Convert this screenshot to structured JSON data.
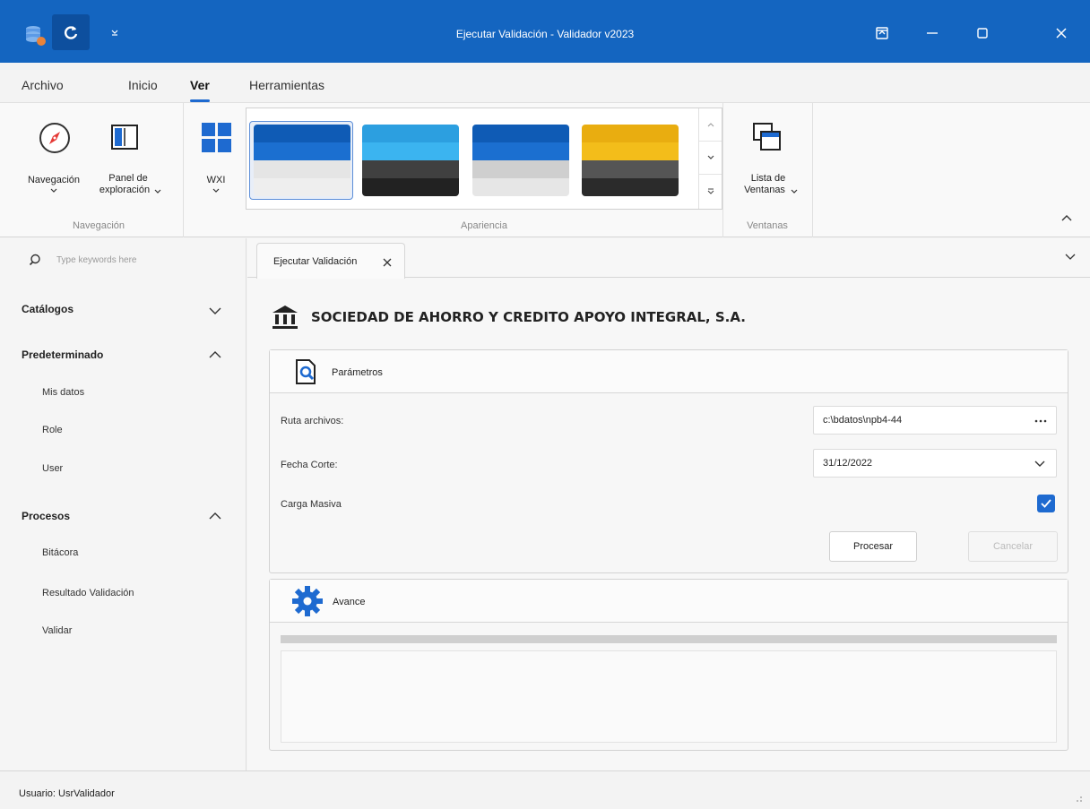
{
  "window": {
    "title": "Ejecutar Validación - Validador v2023",
    "accent": "#1465c0"
  },
  "menu": {
    "tabs": [
      {
        "label": "Archivo"
      },
      {
        "label": "Inicio"
      },
      {
        "label": "Ver",
        "active": true
      },
      {
        "label": "Herramientas"
      }
    ]
  },
  "ribbon": {
    "nav_button": "Navegación",
    "panel_button_line1": "Panel de",
    "panel_button_line2": "exploración",
    "group_navegacion": "Navegación",
    "wxi_button": "WXI",
    "group_apariencia": "Apariencia",
    "ventanas_line1": "Lista de",
    "ventanas_line2": "Ventanas",
    "group_ventanas": "Ventanas",
    "themes": [
      {
        "name": "blue",
        "colors": [
          "#0f5bb5",
          "#1b6fd0",
          "#e5e5e5",
          "#eeeeee"
        ]
      },
      {
        "name": "lightblue",
        "colors": [
          "#2c9fe0",
          "#3bb4f0",
          "#404040",
          "#222222"
        ]
      },
      {
        "name": "blue-gray",
        "colors": [
          "#0f5bb5",
          "#1b6fd0",
          "#cfcfcf",
          "#e6e6e6"
        ]
      },
      {
        "name": "gold",
        "colors": [
          "#e9ad10",
          "#f3bd1a",
          "#555555",
          "#2b2b2b"
        ]
      }
    ]
  },
  "sidebar": {
    "search_placeholder": "Type keywords here",
    "groups": [
      {
        "label": "Catálogos",
        "expanded": false,
        "items": []
      },
      {
        "label": "Predeterminado",
        "expanded": true,
        "items": [
          "Mis datos",
          "Role",
          "User"
        ]
      },
      {
        "label": "Procesos",
        "expanded": true,
        "items": [
          "Bitácora",
          "Resultado Validación",
          "Validar"
        ]
      }
    ]
  },
  "document": {
    "tab_label": "Ejecutar Validación",
    "company": "SOCIEDAD DE AHORRO Y CREDITO APOYO INTEGRAL, S.A.",
    "parametros": {
      "title": "Parámetros",
      "ruta_label": "Ruta archivos:",
      "ruta_value": "c:\\bdatos\\npb4-44",
      "fecha_label": "Fecha Corte:",
      "fecha_value": "31/12/2022",
      "carga_label": "Carga Masiva",
      "carga_checked": true,
      "procesar": "Procesar",
      "cancelar": "Cancelar"
    },
    "avance": {
      "title": "Avance",
      "progress": 0
    }
  },
  "status": {
    "user": "Usuario: UsrValidador"
  }
}
